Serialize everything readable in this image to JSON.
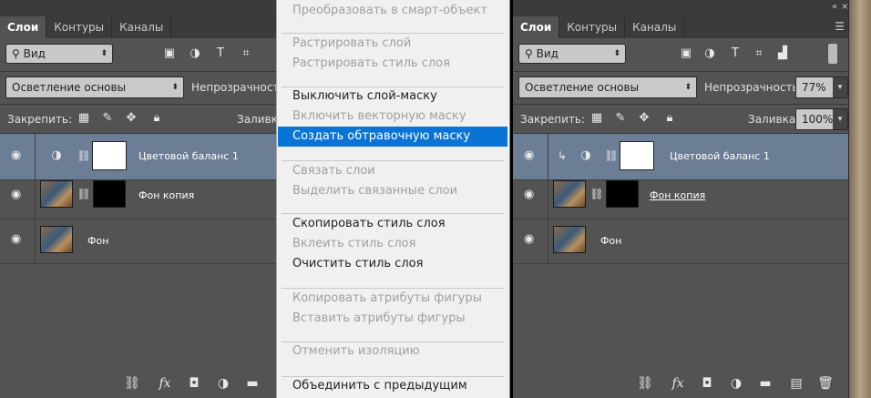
{
  "left": {
    "tabs": [
      "Слои",
      "Контуры",
      "Каналы"
    ],
    "filter_label": "Вид",
    "blend_mode": "Осветление основы",
    "opacity_label": "Непрозрачность:",
    "lock_label": "Закрепить:",
    "fill_label": "Заливка:",
    "layers": [
      {
        "name": "Цветовой баланс 1"
      },
      {
        "name": "Фон копия"
      },
      {
        "name": "Фон"
      }
    ]
  },
  "menu": {
    "items": [
      {
        "label": "Преобразовать в смарт-объект",
        "disabled": true
      },
      {
        "label": "Растрировать слой",
        "disabled": true
      },
      {
        "label": "Растрировать стиль слоя",
        "disabled": true
      },
      {
        "label": "Выключить слой-маску",
        "disabled": false
      },
      {
        "label": "Включить векторную маску",
        "disabled": true
      },
      {
        "label": "Создать обтравочную маску",
        "disabled": false,
        "highlighted": true
      },
      {
        "label": "Связать слои",
        "disabled": true
      },
      {
        "label": "Выделить связанные слои",
        "disabled": true
      },
      {
        "label": "Скопировать стиль слоя",
        "disabled": false
      },
      {
        "label": "Вклеить стиль слоя",
        "disabled": true
      },
      {
        "label": "Очистить стиль слоя",
        "disabled": false
      },
      {
        "label": "Копировать атрибуты фигуры",
        "disabled": true
      },
      {
        "label": "Вставить атрибуты фигуры",
        "disabled": true
      },
      {
        "label": "Отменить изоляцию",
        "disabled": true
      },
      {
        "label": "Объединить с предыдущим",
        "disabled": false
      }
    ]
  },
  "right": {
    "tabs": [
      "Слои",
      "Контуры",
      "Каналы"
    ],
    "filter_label": "Вид",
    "blend_mode": "Осветление основы",
    "opacity_label": "Непрозрачность:",
    "opacity_value": "77%",
    "lock_label": "Закрепить:",
    "fill_label": "Заливка:",
    "fill_value": "100%",
    "layers": [
      {
        "name": "Цветовой баланс 1"
      },
      {
        "name": "Фон копия"
      },
      {
        "name": "Фон"
      }
    ]
  },
  "icons": {
    "eye": "eye-icon",
    "link": "chain-link-icon",
    "fx": "fx",
    "clip": "clip-arrow-icon"
  }
}
